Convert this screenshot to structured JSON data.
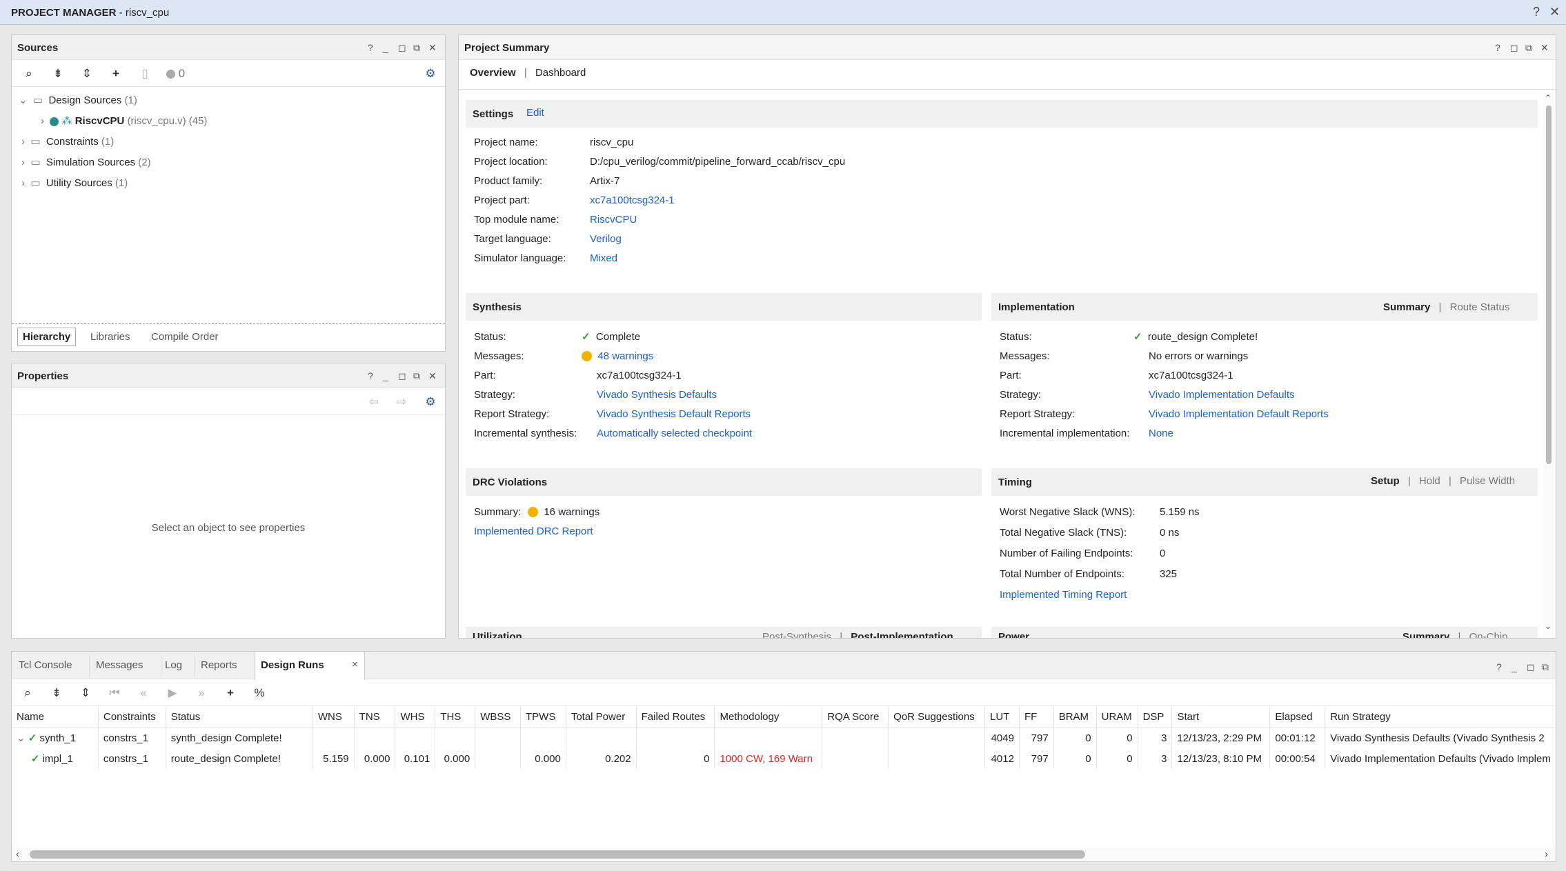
{
  "window": {
    "title_bold": "PROJECT MANAGER",
    "title_rest": " - riscv_cpu",
    "help": "?",
    "close": "✕"
  },
  "sources": {
    "title": "Sources",
    "count": "0",
    "tree": [
      {
        "label": "Design Sources",
        "count": "(1)"
      },
      {
        "label": "RiscvCPU",
        "detail": "(riscv_cpu.v) (45)"
      },
      {
        "label": "Constraints",
        "count": "(1)"
      },
      {
        "label": "Simulation Sources",
        "count": "(2)"
      },
      {
        "label": "Utility Sources",
        "count": "(1)"
      }
    ],
    "tabs": [
      "Hierarchy",
      "Libraries",
      "Compile Order"
    ]
  },
  "properties": {
    "title": "Properties",
    "empty_msg": "Select an object to see properties"
  },
  "summary": {
    "title": "Project Summary",
    "tabs": [
      "Overview",
      "Dashboard"
    ],
    "settings": {
      "title": "Settings",
      "edit": "Edit",
      "rows": [
        {
          "k": "Project name:",
          "v": "riscv_cpu",
          "link": false
        },
        {
          "k": "Project location:",
          "v": "D:/cpu_verilog/commit/pipeline_forward_ccab/riscv_cpu",
          "link": false
        },
        {
          "k": "Product family:",
          "v": "Artix-7",
          "link": false
        },
        {
          "k": "Project part:",
          "v": "xc7a100tcsg324-1",
          "link": true
        },
        {
          "k": "Top module name:",
          "v": "RiscvCPU",
          "link": true
        },
        {
          "k": "Target language:",
          "v": "Verilog",
          "link": true
        },
        {
          "k": "Simulator language:",
          "v": "Mixed",
          "link": true
        }
      ]
    },
    "synthesis": {
      "title": "Synthesis",
      "rows": [
        {
          "k": "Status:",
          "v": "Complete"
        },
        {
          "k": "Messages:",
          "v": "48 warnings"
        },
        {
          "k": "Part:",
          "v": "xc7a100tcsg324-1"
        },
        {
          "k": "Strategy:",
          "v": "Vivado Synthesis Defaults"
        },
        {
          "k": "Report Strategy:",
          "v": "Vivado Synthesis Default Reports"
        },
        {
          "k": "Incremental synthesis:",
          "v": "Automatically selected checkpoint"
        }
      ]
    },
    "implementation": {
      "title": "Implementation",
      "tab1": "Summary",
      "tab2": "Route Status",
      "rows": [
        {
          "k": "Status:",
          "v": "route_design Complete!"
        },
        {
          "k": "Messages:",
          "v": "No errors or warnings"
        },
        {
          "k": "Part:",
          "v": "xc7a100tcsg324-1"
        },
        {
          "k": "Strategy:",
          "v": "Vivado Implementation Defaults"
        },
        {
          "k": "Report Strategy:",
          "v": "Vivado Implementation Default Reports"
        },
        {
          "k": "Incremental implementation:",
          "v": "None"
        }
      ]
    },
    "drc": {
      "title": "DRC Violations",
      "summary_k": "Summary:",
      "summary_v": "16 warnings",
      "report": "Implemented DRC Report"
    },
    "timing": {
      "title": "Timing",
      "tabs": [
        "Setup",
        "Hold",
        "Pulse Width"
      ],
      "rows": [
        {
          "k": "Worst Negative Slack (WNS):",
          "v": "5.159 ns"
        },
        {
          "k": "Total Negative Slack (TNS):",
          "v": "0 ns"
        },
        {
          "k": "Number of Failing Endpoints:",
          "v": "0"
        },
        {
          "k": "Total Number of Endpoints:",
          "v": "325"
        }
      ],
      "report": "Implemented Timing Report"
    },
    "cut_left": {
      "title": "Utilization",
      "tab1": "Post-Synthesis",
      "tab2": "Post-Implementation"
    },
    "cut_right": {
      "title": "Power",
      "tab1": "Summary",
      "tab2": "On-Chip"
    }
  },
  "bottom": {
    "tabs": [
      "Tcl Console",
      "Messages",
      "Log",
      "Reports",
      "Design Runs"
    ],
    "close": "×",
    "columns": [
      "Name",
      "Constraints",
      "Status",
      "WNS",
      "TNS",
      "WHS",
      "THS",
      "WBSS",
      "TPWS",
      "Total Power",
      "Failed Routes",
      "Methodology",
      "RQA Score",
      "QoR Suggestions",
      "LUT",
      "FF",
      "BRAM",
      "URAM",
      "DSP",
      "Start",
      "Elapsed",
      "Run Strategy"
    ],
    "runs": [
      {
        "name": "synth_1",
        "constraints": "constrs_1",
        "status": "synth_design Complete!",
        "wns": "",
        "tns": "",
        "whs": "",
        "ths": "",
        "wbss": "",
        "tpws": "",
        "power": "",
        "failed": "",
        "method": "",
        "rqa": "",
        "qor": "",
        "lut": "4049",
        "ff": "797",
        "bram": "0",
        "uram": "0",
        "dsp": "3",
        "start": "12/13/23, 2:29 PM",
        "elapsed": "00:01:12",
        "strategy": "Vivado Synthesis Defaults (Vivado Synthesis 2"
      },
      {
        "name": "impl_1",
        "constraints": "constrs_1",
        "status": "route_design Complete!",
        "wns": "5.159",
        "tns": "0.000",
        "whs": "0.101",
        "ths": "0.000",
        "wbss": "",
        "tpws": "0.000",
        "power": "0.202",
        "failed": "0",
        "method": "1000 CW, 169 Warn",
        "rqa": "",
        "qor": "",
        "lut": "4012",
        "ff": "797",
        "bram": "0",
        "uram": "0",
        "dsp": "3",
        "start": "12/13/23, 8:10 PM",
        "elapsed": "00:00:54",
        "strategy": "Vivado Implementation Defaults (Vivado Implem"
      }
    ]
  },
  "colors": {
    "accent_link": "#1a5fd1",
    "check": "#2e9e3a",
    "warning": "#f2b300",
    "error_text": "#d22222"
  }
}
